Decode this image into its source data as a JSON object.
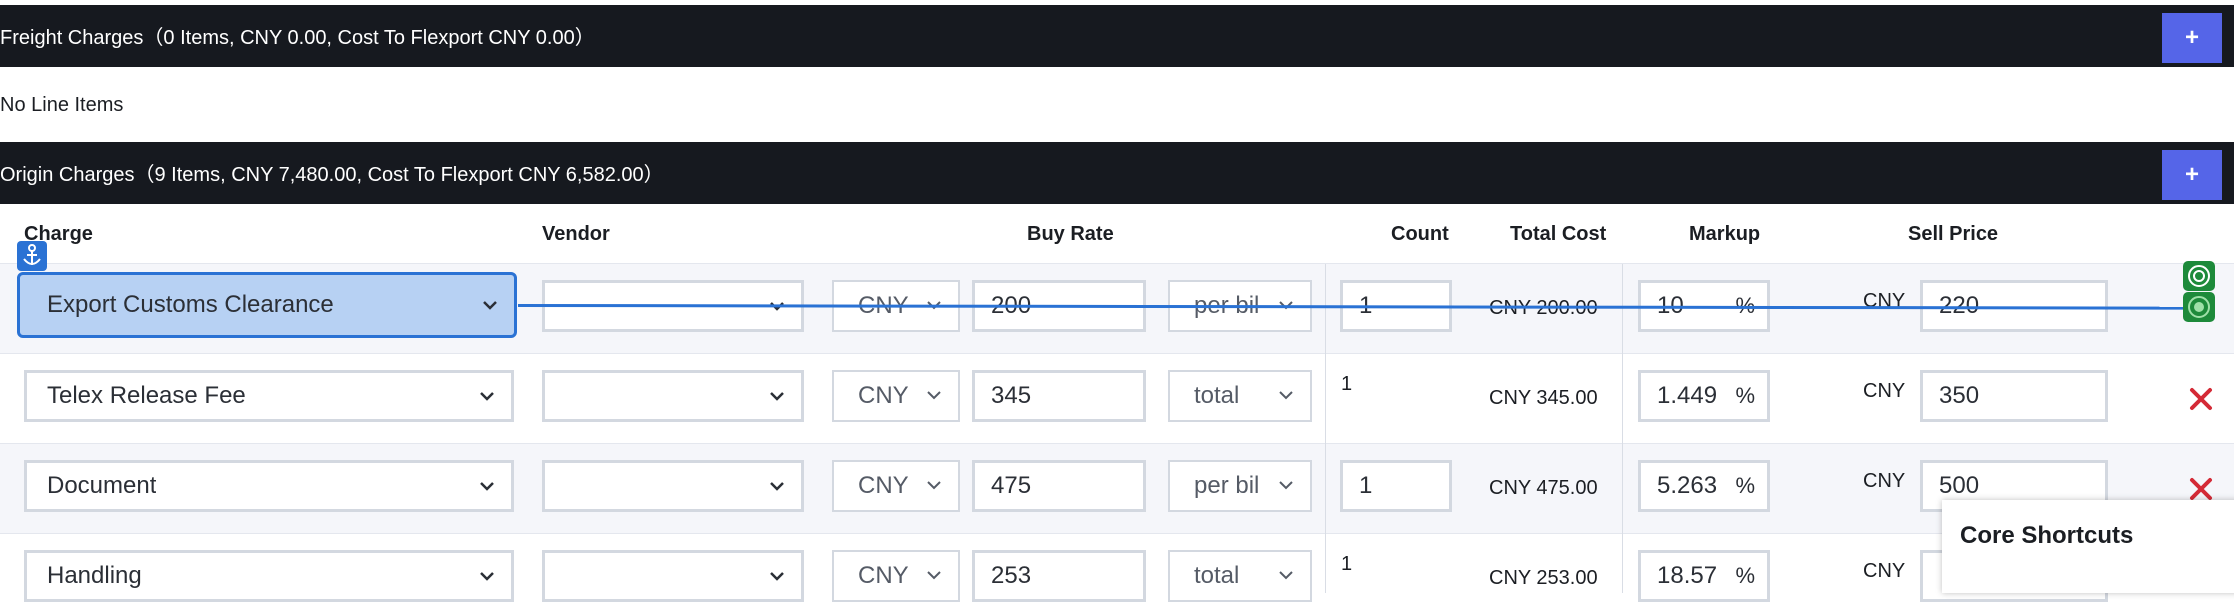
{
  "freight": {
    "title": "Freight Charges（0 Items, CNY 0.00, Cost To Flexport CNY 0.00）",
    "add_label": "+",
    "empty": "No Line Items"
  },
  "origin": {
    "title": "Origin Charges（9 Items, CNY 7,480.00, Cost To Flexport CNY 6,582.00）",
    "add_label": "+"
  },
  "headers": {
    "charge": "Charge",
    "vendor": "Vendor",
    "buy_rate": "Buy Rate",
    "count": "Count",
    "total_cost": "Total Cost",
    "markup": "Markup",
    "sell_price": "Sell Price"
  },
  "rows": [
    {
      "charge": "Export Customs Clearance",
      "vendor": "",
      "currency": "CNY",
      "buy": "200",
      "unit": "per bil",
      "count": "1",
      "total": "CNY 200.00",
      "markup": "10",
      "pct": "%",
      "sell_cur": "CNY",
      "sell": "220"
    },
    {
      "charge": "Telex Release Fee",
      "vendor": "",
      "currency": "CNY",
      "buy": "345",
      "unit": "total",
      "count": "1",
      "total": "CNY 345.00",
      "markup": "1.449",
      "pct": "%",
      "sell_cur": "CNY",
      "sell": "350"
    },
    {
      "charge": "Document",
      "vendor": "",
      "currency": "CNY",
      "buy": "475",
      "unit": "per bil",
      "count": "1",
      "total": "CNY 475.00",
      "markup": "5.263",
      "pct": "%",
      "sell_cur": "CNY",
      "sell": "500"
    },
    {
      "charge": "Handling",
      "vendor": "",
      "currency": "CNY",
      "buy": "253",
      "unit": "total",
      "count": "1",
      "total": "CNY 253.00",
      "markup": "18.57",
      "pct": "%",
      "sell_cur": "CNY",
      "sell": ""
    }
  ],
  "popup": {
    "title": "Core Shortcuts"
  },
  "colors": {
    "bar": "#16191f",
    "accent": "#5565e8",
    "highlight": "#2a72d4",
    "delete": "#d42a36",
    "ok": "#1d8a3a"
  }
}
